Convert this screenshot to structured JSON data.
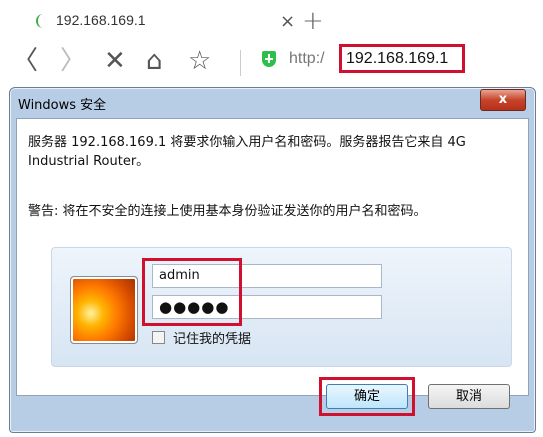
{
  "browser": {
    "tab_title": "192.168.169.1",
    "tab_close": "×",
    "new_tab": "+",
    "nav": {
      "back": "〈",
      "forward": "〉",
      "stop": "✕",
      "home": "⌂",
      "favorite": "☆"
    },
    "url_prefix": "http:/",
    "url_host": "192.168.169.1"
  },
  "dialog": {
    "title": "Windows 安全",
    "close_label": "x",
    "message": "服务器 192.168.169.1 将要求你输入用户名和密码。服务器报告它来自 4G Industrial Router。",
    "warning": "警告: 将在不安全的连接上使用基本身份验证发送你的用户名和密码。",
    "username": "admin",
    "password": "●●●●●",
    "remember_label": "记住我的凭据",
    "ok_label": "确定",
    "cancel_label": "取消"
  },
  "colors": {
    "highlight": "#d0102f",
    "dialog_frame": "#b7cde5",
    "secure_icon": "#2dbf4b"
  },
  "icons": [
    "loading-icon",
    "shield-icon",
    "avatar-icon"
  ]
}
